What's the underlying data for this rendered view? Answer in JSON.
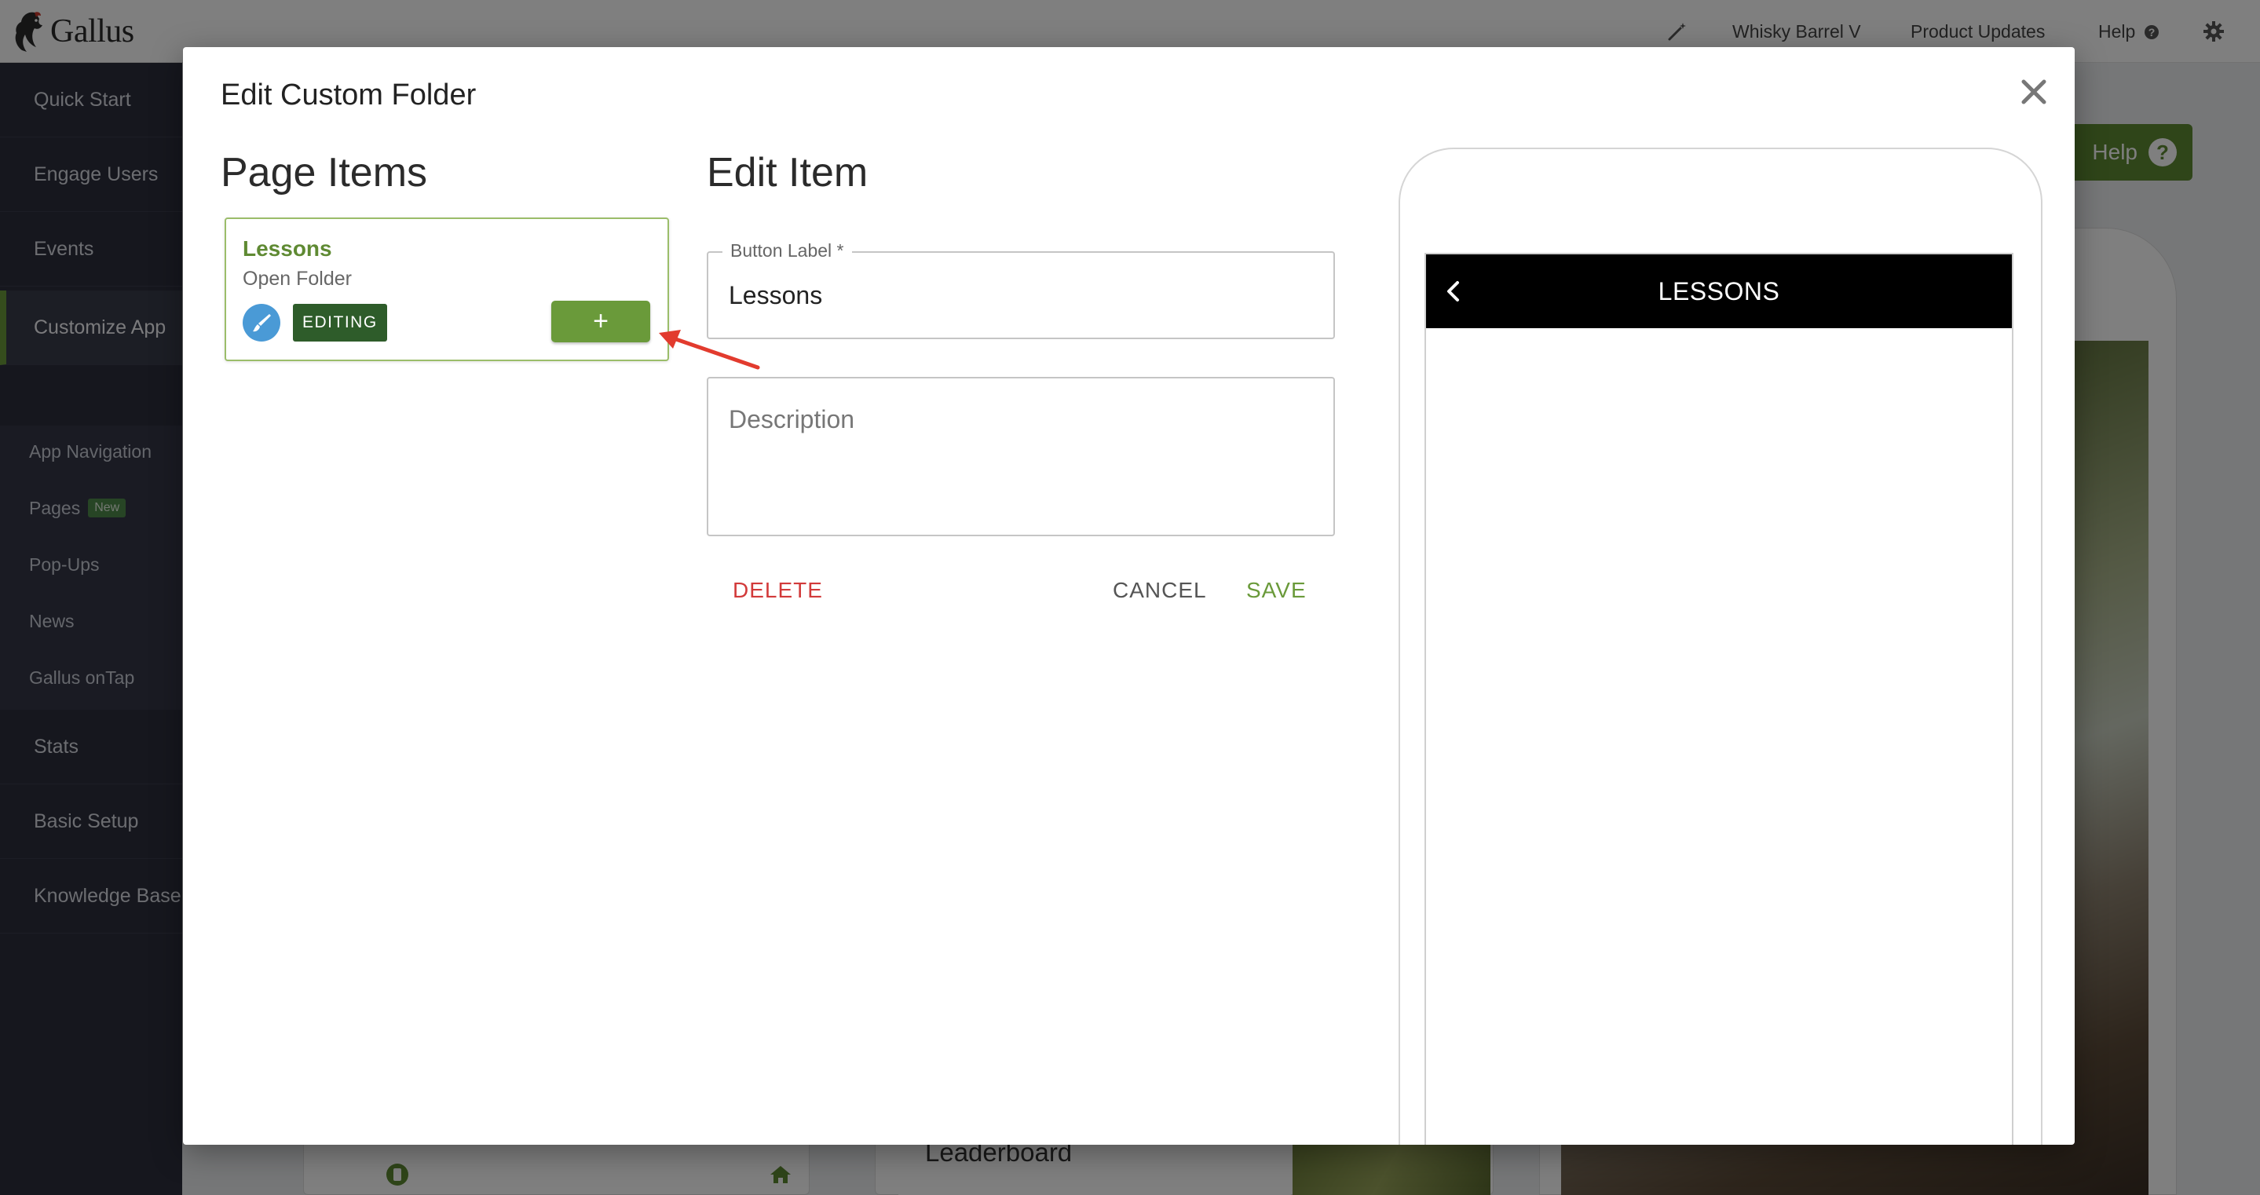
{
  "app": {
    "logo_text": "Gallus",
    "topnav": {
      "account": "Whisky Barrel V",
      "product_updates": "Product Updates",
      "help": "Help"
    }
  },
  "sidebar": {
    "items": [
      {
        "label": "Quick Start"
      },
      {
        "label": "Engage Users"
      },
      {
        "label": "Events"
      },
      {
        "label": "Customize App",
        "active": true
      },
      {
        "label": "Stats"
      },
      {
        "label": "Basic Setup"
      },
      {
        "label": "Knowledge Base"
      }
    ],
    "subitems": [
      {
        "label": "App Navigation"
      },
      {
        "label": "Pages",
        "badge": "New"
      },
      {
        "label": "Pop-Ups"
      },
      {
        "label": "News"
      },
      {
        "label": "Gallus onTap"
      }
    ]
  },
  "background": {
    "help_button": "Help",
    "leaderboard": "Leaderboard"
  },
  "modal": {
    "title": "Edit Custom Folder",
    "page_items_title": "Page Items",
    "edit_item_title": "Edit Item",
    "item": {
      "name": "Lessons",
      "type": "Open Folder",
      "editing_badge": "EDITING",
      "add_symbol": "+"
    },
    "form": {
      "button_label_label": "Button Label *",
      "button_label_value": "Lessons",
      "description_placeholder": "Description",
      "delete": "DELETE",
      "cancel": "CANCEL",
      "save": "SAVE"
    },
    "preview": {
      "header_title": "LESSONS"
    }
  },
  "colors": {
    "brand_green": "#6a9a3a",
    "delete_red": "#d23a3a",
    "save_green": "#6a9a3a",
    "sidebar_bg": "#2c2f3d"
  }
}
